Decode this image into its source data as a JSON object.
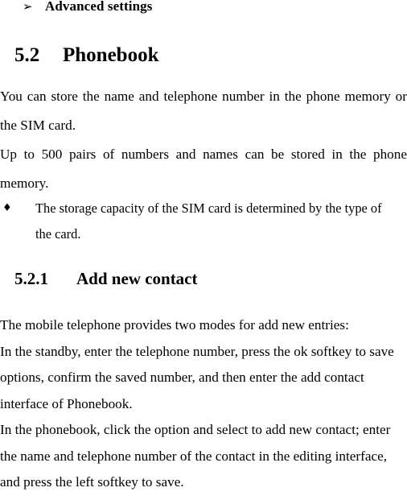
{
  "document": {
    "arrow_bullet": {
      "icon": "arrow-right-bullet-icon",
      "glyph": "➢",
      "label": "Advanced settings"
    },
    "section": {
      "number": "5.2",
      "title": "Phonebook"
    },
    "intro_paragraph": {
      "line_1": "You can store the name and telephone number in the phone memory or the SIM card.",
      "line_2": "Up to 500 pairs of numbers and names can be stored in the phone memory."
    },
    "diamond_bullet": {
      "icon": "diamond-bullet-icon",
      "glyph": "♦",
      "text": "The storage capacity of the SIM card is determined by the type of the card."
    },
    "subsection": {
      "number": "5.2.1",
      "title": "Add new contact"
    },
    "body": {
      "line_1": "The mobile telephone provides two modes for add new entries:",
      "line_2": "In the standby, enter the telephone number, press the ok softkey to save options, confirm the saved number, and then enter the add contact interface of Phonebook.",
      "line_3": "In the phonebook, click the option and select to add new contact; enter the name and telephone number of the contact in the editing interface, and press the left softkey to save."
    }
  }
}
